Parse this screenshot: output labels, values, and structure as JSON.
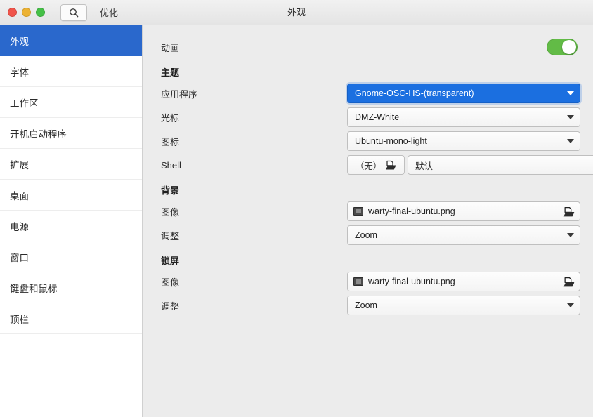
{
  "titlebar": {
    "app_name": "优化",
    "window_title": "外观",
    "search_icon": "search-icon",
    "traffic_lights": [
      {
        "name": "close",
        "color": "#f0544a"
      },
      {
        "name": "minimize",
        "color": "#ecb233"
      },
      {
        "name": "maximize",
        "color": "#45c047"
      }
    ]
  },
  "sidebar": {
    "items": [
      {
        "label": "外观",
        "key": "appearance",
        "selected": true
      },
      {
        "label": "字体",
        "key": "fonts",
        "selected": false
      },
      {
        "label": "工作区",
        "key": "workspaces",
        "selected": false
      },
      {
        "label": "开机启动程序",
        "key": "startup-applications",
        "selected": false
      },
      {
        "label": "扩展",
        "key": "extensions",
        "selected": false
      },
      {
        "label": "桌面",
        "key": "desktop",
        "selected": false
      },
      {
        "label": "电源",
        "key": "power",
        "selected": false
      },
      {
        "label": "窗口",
        "key": "windows",
        "selected": false
      },
      {
        "label": "键盘和鼠标",
        "key": "keyboard-mouse",
        "selected": false
      },
      {
        "label": "顶栏",
        "key": "top-bar",
        "selected": false
      }
    ]
  },
  "content": {
    "animation": {
      "label": "动画",
      "enabled": true,
      "switch_color": "#62bb46"
    },
    "theme": {
      "heading": "主题",
      "applications": {
        "label": "应用程序",
        "value": "Gnome-OSC-HS-(transparent)",
        "selected": true,
        "accent_color": "#1b6fe0"
      },
      "cursor": {
        "label": "光标",
        "value": "DMZ-White"
      },
      "icons": {
        "label": "图标",
        "value": "Ubuntu-mono-light"
      },
      "shell": {
        "label": "Shell",
        "button_value": "（无）",
        "value": "默认"
      }
    },
    "background": {
      "heading": "背景",
      "image": {
        "label": "图像",
        "value": "warty-final-ubuntu.png"
      },
      "adjustment": {
        "label": "调整",
        "value": "Zoom"
      }
    },
    "lockscreen": {
      "heading": "锁屏",
      "image": {
        "label": "图像",
        "value": "warty-final-ubuntu.png"
      },
      "adjustment": {
        "label": "调整",
        "value": "Zoom"
      }
    }
  }
}
